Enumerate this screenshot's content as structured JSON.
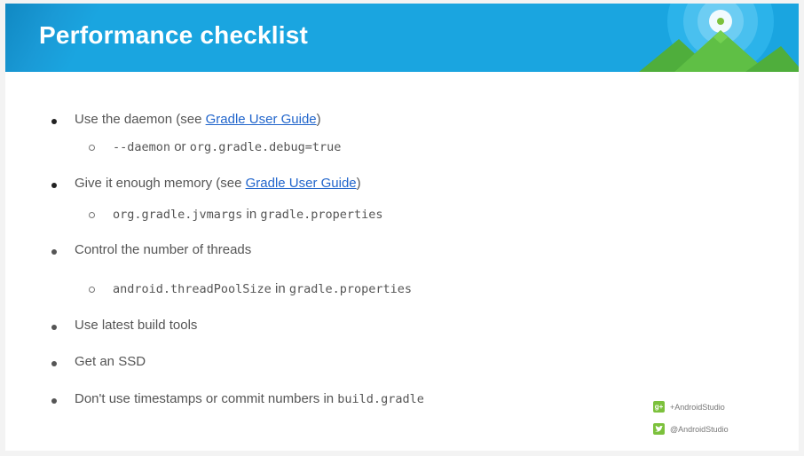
{
  "slide": {
    "title": "Performance checklist",
    "items": [
      {
        "prefix": "Use the daemon (see ",
        "link": "Gradle User Guide",
        "suffix": ")",
        "sub": {
          "code1": "--daemon",
          "text": " or ",
          "code2": "org.gradle.debug=true"
        }
      },
      {
        "prefix": "Give it enough memory (see ",
        "link": "Gradle User Guide",
        "suffix": ")",
        "sub": {
          "code1": "org.gradle.jvmargs",
          "text": " in ",
          "code2": "gradle.properties"
        }
      },
      {
        "text": "Control the number of threads",
        "sub": {
          "code1": "android.threadPoolSize",
          "text": " in ",
          "code2": "gradle.properties"
        }
      },
      {
        "text": "Use latest build tools"
      },
      {
        "text": "Get an SSD"
      },
      {
        "text": "Don't use timestamps or commit numbers in ",
        "code": "build.gradle"
      }
    ],
    "social": {
      "gplus": "+AndroidStudio",
      "twitter": "@AndroidStudio",
      "gplus_icon": "g+",
      "twitter_icon": "twitter-bird"
    },
    "colors": {
      "header": "#1aa5e0",
      "link": "#2266cc",
      "social_badge": "#7cc13c"
    }
  }
}
